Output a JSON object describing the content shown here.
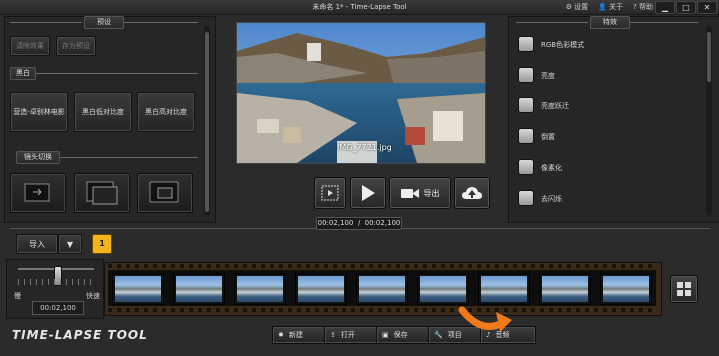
{
  "window": {
    "title": "未命名 1* - Time-Lapse Tool",
    "links": {
      "settings": "设置",
      "about": "关于",
      "help": "帮助"
    }
  },
  "presets": {
    "header": "预设",
    "clear_effects": "清除效果",
    "save_preset": "存为预设",
    "bw_header": "黑白",
    "bw_buttons": [
      "营造-卓别林电影",
      "黑白低对比度",
      "黑白高对比度"
    ],
    "lens_header": "镜头切换"
  },
  "preview": {
    "filename": "IMG_7721.jpg"
  },
  "controls": {
    "export_label": "导出"
  },
  "timecode": "00:02,100  /  00:02,100",
  "effects": {
    "header": "特效",
    "items": [
      "RGB色彩模式",
      "亮度",
      "亮度跃迁",
      "倒置",
      "像素化",
      "去闪烁"
    ]
  },
  "import": {
    "label": "导入",
    "dropdown": "▼",
    "badge": "1"
  },
  "speed": {
    "slow": "慢",
    "fast": "快速",
    "value": "00:02,100"
  },
  "filmstrip": {
    "frame_count": 9
  },
  "logo": "TIME-LAPSE TOOL",
  "bottom": {
    "new": "新建",
    "open": "打开",
    "save": "保存",
    "project": "项目",
    "audio": "音频"
  }
}
